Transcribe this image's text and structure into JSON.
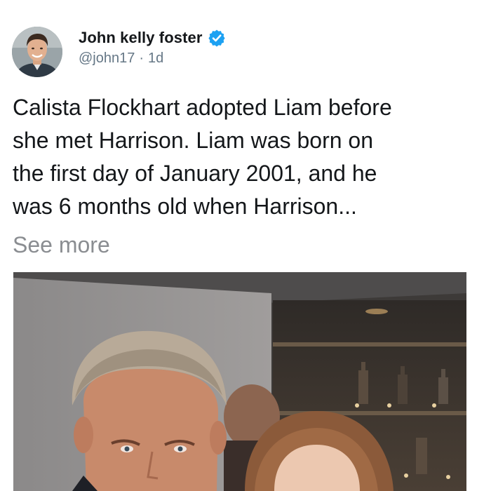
{
  "user": {
    "display_name": "John kelly foster",
    "handle": "@john17",
    "separator": "·",
    "time": "1d",
    "verified": true,
    "avatar_icon": "profile-photo"
  },
  "tweet": {
    "lines": [
      "Calista Flockhart adopted Liam before",
      "she met Harrison. Liam was born on",
      "the first day of January 2001, and he",
      "was 6 months old when Harrison..."
    ],
    "see_more": "See more"
  },
  "colors": {
    "verified_badge": "#1da1f2",
    "text": "#14171a",
    "secondary": "#657786",
    "see_more": "#8a8d91"
  }
}
